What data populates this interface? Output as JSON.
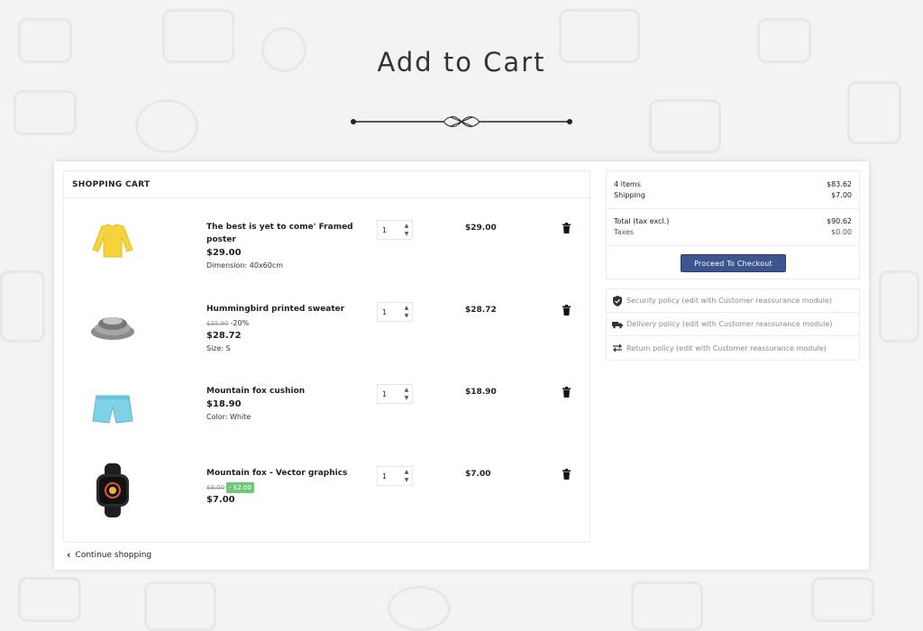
{
  "page": {
    "title": "Add to Cart"
  },
  "cart": {
    "header": "SHOPPING CART",
    "items": [
      {
        "name": "The best is yet to come' Framed poster",
        "old_price": "",
        "discount": "",
        "price": "$29.00",
        "attribute": "Dimension: 40x60cm",
        "quantity": "1",
        "total": "$29.00",
        "image": "yellow-sweater-icon"
      },
      {
        "name": "Hummingbird printed sweater",
        "old_price": "$35.90",
        "discount": "-20%",
        "price": "$28.72",
        "attribute": "Size: S",
        "quantity": "1",
        "total": "$28.72",
        "image": "plates-icon"
      },
      {
        "name": "Mountain fox cushion",
        "old_price": "",
        "discount": "",
        "price": "$18.90",
        "attribute": "Color: White",
        "quantity": "1",
        "total": "$18.90",
        "image": "shorts-icon"
      },
      {
        "name": "Mountain fox - Vector graphics",
        "old_price": "$9.00",
        "discount": "- $2.00",
        "price": "$7.00",
        "attribute": "",
        "quantity": "1",
        "total": "$7.00",
        "image": "watch-icon"
      }
    ],
    "continue_label": "Continue shopping"
  },
  "summary": {
    "items_label": "4 items",
    "items_value": "$83.62",
    "shipping_label": "Shipping",
    "shipping_value": "$7.00",
    "total_label": "Total (tax excl.)",
    "total_value": "$90.62",
    "taxes_label": "Taxes",
    "taxes_value": "$0.00",
    "checkout_label": "Proceed To Checkout"
  },
  "reassurance": [
    {
      "label": "Security policy (edit with Customer reassurance module)",
      "icon": "shield-icon"
    },
    {
      "label": "Delivery policy (edit with Customer reassurance module)",
      "icon": "truck-icon"
    },
    {
      "label": "Return policy (edit with Customer reassurance module)",
      "icon": "exchange-icon"
    }
  ],
  "colors": {
    "checkout": "#3c5490",
    "discount_badge": "#6fc777",
    "background": "#f3f3f3"
  }
}
